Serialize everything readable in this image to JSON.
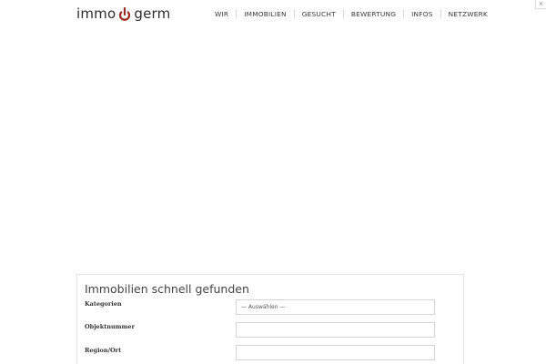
{
  "header": {
    "logo_left": "immo",
    "logo_right": "germ",
    "nav": [
      "WIR",
      "IMMOBILIEN",
      "GESUCHT",
      "BEWERTUNG",
      "INFOS",
      "NETZWERK"
    ],
    "corner_glyph": "×"
  },
  "search": {
    "title": "Immobilien schnell gefunden",
    "fields": [
      {
        "label": "Kategorien",
        "value": "— Auswählen —"
      },
      {
        "label": "Objektnummer",
        "value": ""
      },
      {
        "label": "Region/Ort",
        "value": ""
      }
    ]
  },
  "colors": {
    "brand_accent": "#9a2a22",
    "text": "#333333",
    "border": "#e6e6e6"
  }
}
